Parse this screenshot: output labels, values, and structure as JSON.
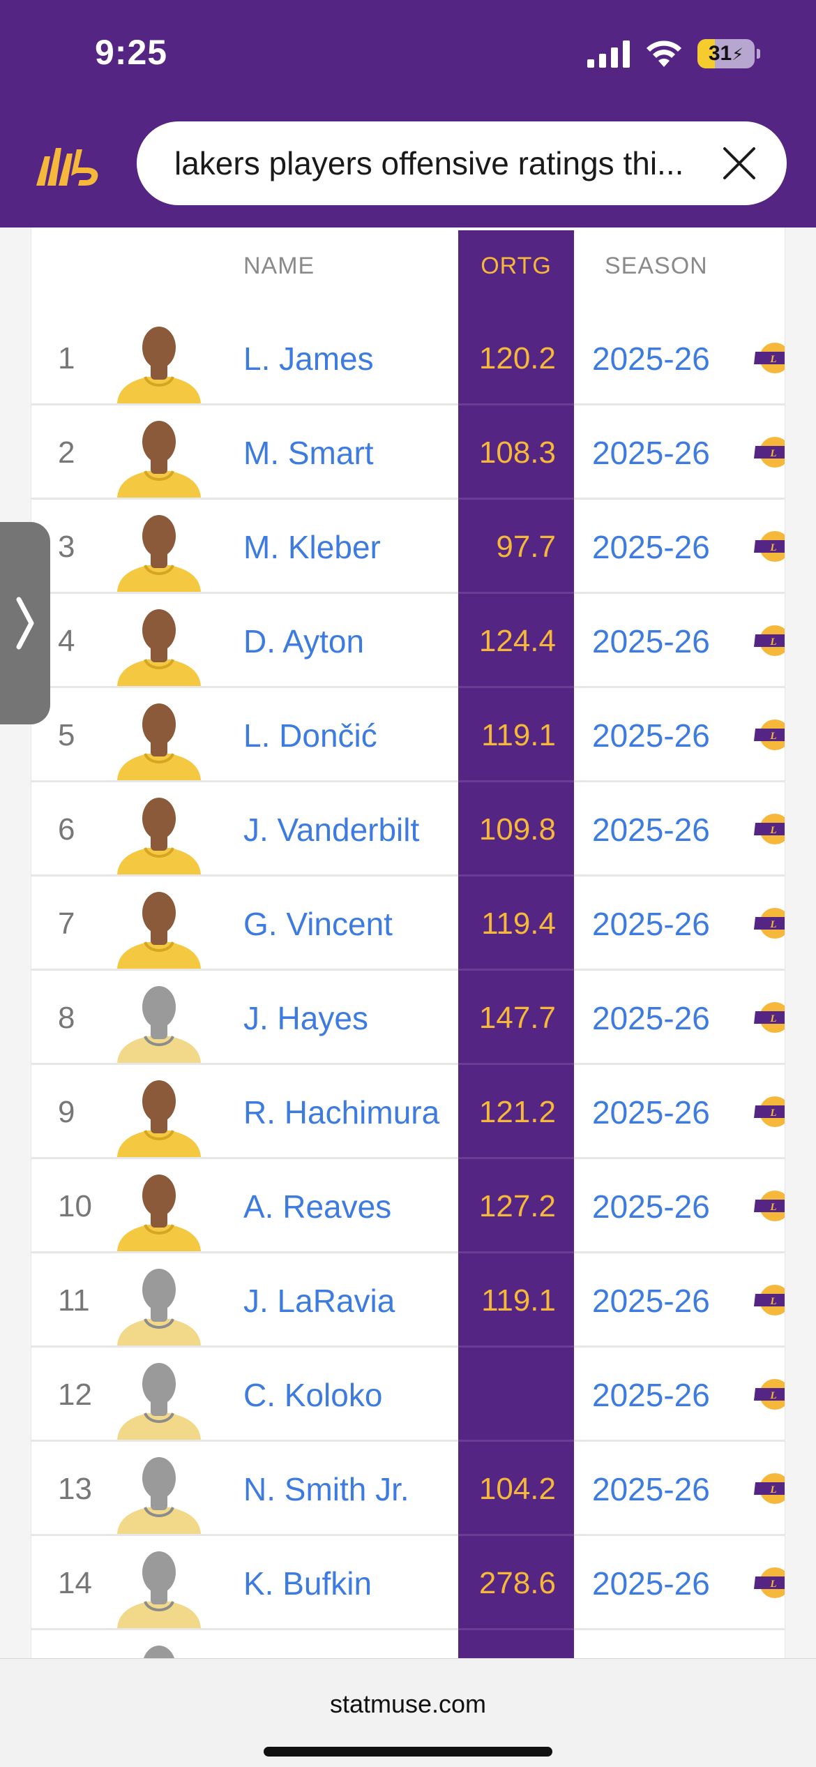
{
  "status": {
    "time": "9:25",
    "battery": "31",
    "battery_level": 0.31
  },
  "search": {
    "query": "lakers players offensive ratings thi..."
  },
  "table": {
    "columns": {
      "name": "NAME",
      "ortg": "ORTG",
      "season": "SEASON"
    },
    "rows": [
      {
        "rank": "1",
        "name": "L. James",
        "ortg": "120.2",
        "season": "2025-26",
        "headshot": "player-photo"
      },
      {
        "rank": "2",
        "name": "M. Smart",
        "ortg": "108.3",
        "season": "2025-26",
        "headshot": "player-photo"
      },
      {
        "rank": "3",
        "name": "M. Kleber",
        "ortg": "97.7",
        "season": "2025-26",
        "headshot": "player-photo"
      },
      {
        "rank": "4",
        "name": "D. Ayton",
        "ortg": "124.4",
        "season": "2025-26",
        "headshot": "player-photo"
      },
      {
        "rank": "5",
        "name": "L. Dončić",
        "ortg": "119.1",
        "season": "2025-26",
        "headshot": "player-photo"
      },
      {
        "rank": "6",
        "name": "J. Vanderbilt",
        "ortg": "109.8",
        "season": "2025-26",
        "headshot": "player-photo"
      },
      {
        "rank": "7",
        "name": "G. Vincent",
        "ortg": "119.4",
        "season": "2025-26",
        "headshot": "player-photo"
      },
      {
        "rank": "8",
        "name": "J. Hayes",
        "ortg": "147.7",
        "season": "2025-26",
        "headshot": "silhouette"
      },
      {
        "rank": "9",
        "name": "R. Hachimura",
        "ortg": "121.2",
        "season": "2025-26",
        "headshot": "player-photo"
      },
      {
        "rank": "10",
        "name": "A. Reaves",
        "ortg": "127.2",
        "season": "2025-26",
        "headshot": "player-photo"
      },
      {
        "rank": "11",
        "name": "J. LaRavia",
        "ortg": "119.1",
        "season": "2025-26",
        "headshot": "silhouette"
      },
      {
        "rank": "12",
        "name": "C. Koloko",
        "ortg": "",
        "season": "2025-26",
        "headshot": "silhouette"
      },
      {
        "rank": "13",
        "name": "N. Smith Jr.",
        "ortg": "104.2",
        "season": "2025-26",
        "headshot": "silhouette"
      },
      {
        "rank": "14",
        "name": "K. Bufkin",
        "ortg": "278.6",
        "season": "2025-26",
        "headshot": "silhouette"
      },
      {
        "rank": "",
        "name": "",
        "ortg": "",
        "season": "",
        "headshot": "silhouette"
      }
    ]
  },
  "footer": {
    "url": "statmuse.com"
  },
  "colors": {
    "brand_purple": "#552583",
    "lakers_gold": "#f5b83a",
    "link_blue": "#3d7be0"
  }
}
